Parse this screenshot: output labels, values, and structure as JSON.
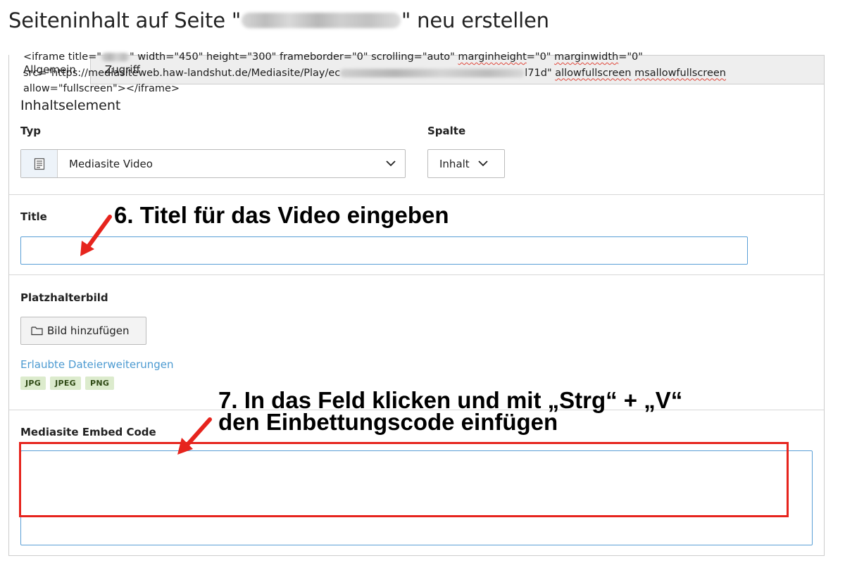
{
  "page": {
    "title_prefix": "Seiteninhalt auf Seite \"",
    "title_suffix": "\" neu erstellen"
  },
  "tabs": [
    {
      "label": "Allgemein",
      "active": true
    },
    {
      "label": "Zugriff",
      "active": false
    }
  ],
  "content_element": {
    "legend": "Inhaltselement",
    "type_label": "Typ",
    "type_value": "Mediasite Video",
    "type_icon": "document-list-icon",
    "column_label": "Spalte",
    "column_value": "Inhalt"
  },
  "title_field": {
    "label": "Title",
    "value": ""
  },
  "placeholder_image": {
    "label": "Platzhalterbild",
    "button_label": "Bild hinzufügen",
    "button_icon": "folder-icon",
    "allowed_link": "Erlaubte Dateierweiterungen",
    "extensions": [
      "JPG",
      "JPEG",
      "PNG"
    ]
  },
  "embed_code": {
    "label": "Mediasite Embed Code",
    "line1_a": "<iframe title=\"",
    "line1_b": "\" width=\"450\" height=\"300\" frameborder=\"0\" scrolling=\"auto\" ",
    "line1_c": "marginheight",
    "line1_d": "=\"0\" ",
    "line1_e": "marginwidth",
    "line1_f": "=\"0\"",
    "line2_a": "src=\"https://mediasiteweb.haw-landshut.de/Mediasite/Play/ec",
    "line2_b": "l71d\" ",
    "line2_c": "allowfullscreen",
    "line2_d": " ",
    "line2_e": "msallowfullscreen",
    "line3": "allow=\"fullscreen\"></iframe>"
  },
  "annotations": {
    "step6": "6. Titel  für das Video eingeben",
    "step7_line1": "7. In das Feld klicken und mit „Strg“ + „V“",
    "step7_line2": "den Einbettungscode einfügen"
  },
  "colors": {
    "annotation_red": "#e6241d",
    "input_focus_blue": "#5a9fd6",
    "link_blue": "#4c9ad1",
    "badge_green_bg": "#dcebcd"
  }
}
